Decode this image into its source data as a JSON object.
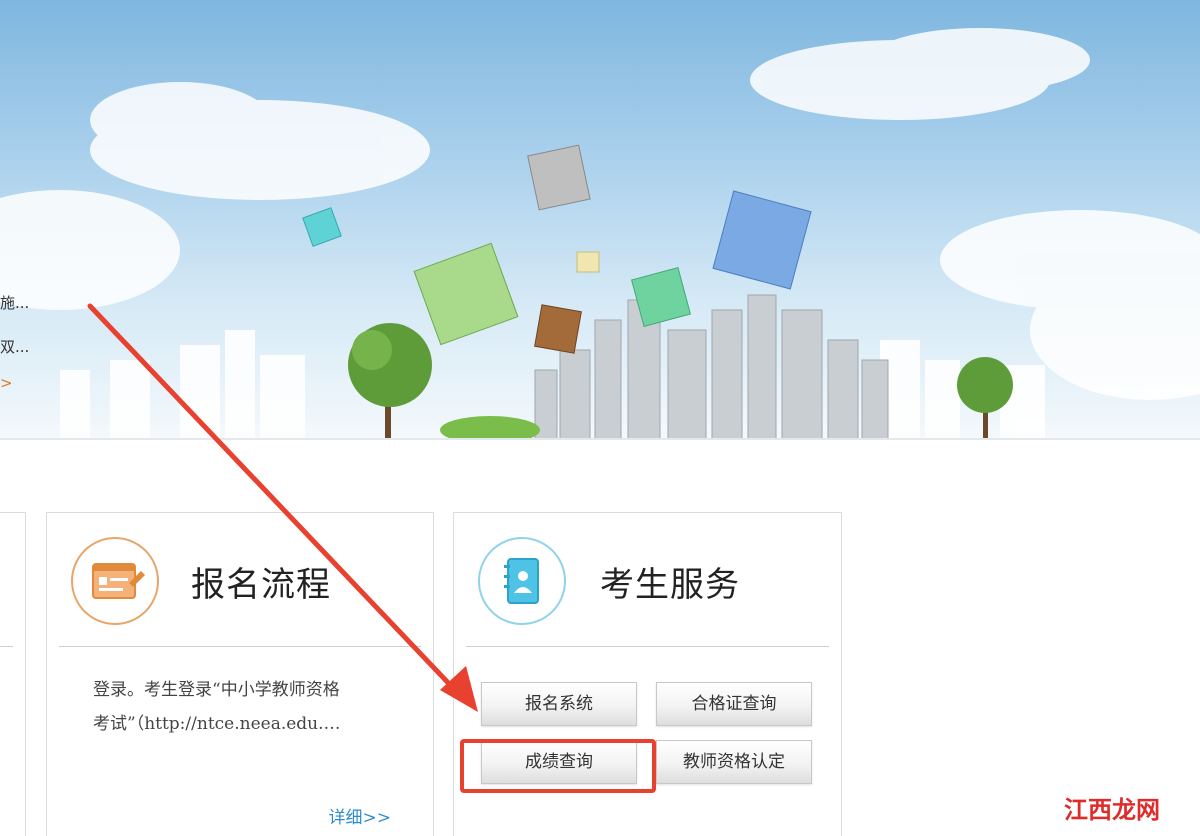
{
  "banner": {
    "snippets": [
      "施...",
      "双...",
      ">"
    ]
  },
  "cards": {
    "process": {
      "title": "报名流程",
      "body_line1": "登录。考生登录“中小学教师资格",
      "body_line2": "考试”（http://ntce.neea.edu.…",
      "more": "详细>>"
    },
    "service": {
      "title": "考生服务",
      "buttons": [
        "报名系统",
        "合格证查询",
        "成绩查询",
        "教师资格认定"
      ]
    }
  },
  "annotation": {
    "arrow_color": "#e8412f",
    "highlight_target": "成绩查询"
  },
  "watermark": "江西龙网",
  "colors": {
    "orange_icon": "#e8a56a",
    "blue_icon": "#8fd3ea",
    "link": "#2e8ccc",
    "annotation": "#e8412f"
  }
}
